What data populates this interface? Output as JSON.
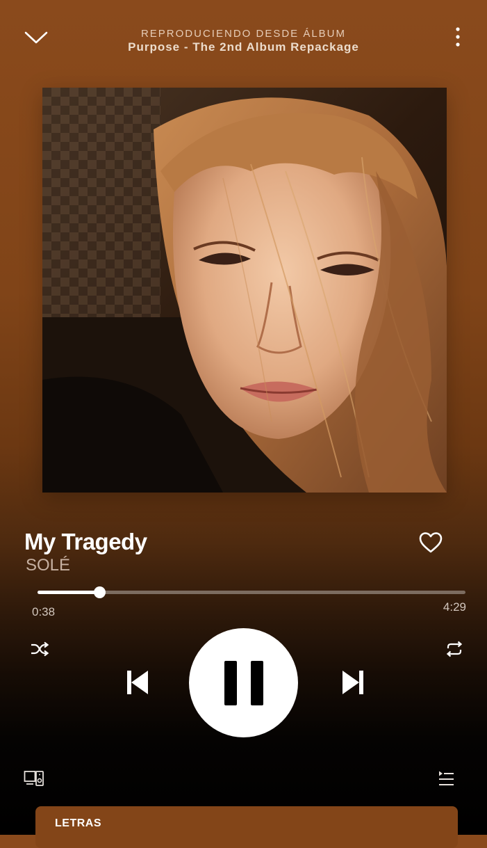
{
  "header": {
    "context_label": "REPRODUCIENDO DESDE ÁLBUM",
    "album_name": "Purpose - The 2nd Album Repackage",
    "collapse_icon": "chevron-down-icon",
    "more_icon": "more-vertical-icon"
  },
  "album_art": {
    "icon": "album-cover-image"
  },
  "track": {
    "title": "My Tragedy",
    "artist": "SOLÉ",
    "liked": false
  },
  "playback": {
    "elapsed": "0:38",
    "total": "4:29",
    "progress_fraction": 0.144,
    "state": "playing"
  },
  "controls": {
    "shuffle_icon": "shuffle-icon",
    "previous_icon": "skip-previous-icon",
    "pause_icon": "pause-icon",
    "next_icon": "skip-next-icon",
    "repeat_icon": "repeat-icon",
    "devices_icon": "devices-icon",
    "queue_icon": "queue-icon"
  },
  "lyrics": {
    "label": "LETRAS"
  },
  "colors": {
    "background_top": "#8a4a1c",
    "background_bottom": "#000000",
    "lyrics_card": "#834518",
    "accent": "#ffffff"
  }
}
